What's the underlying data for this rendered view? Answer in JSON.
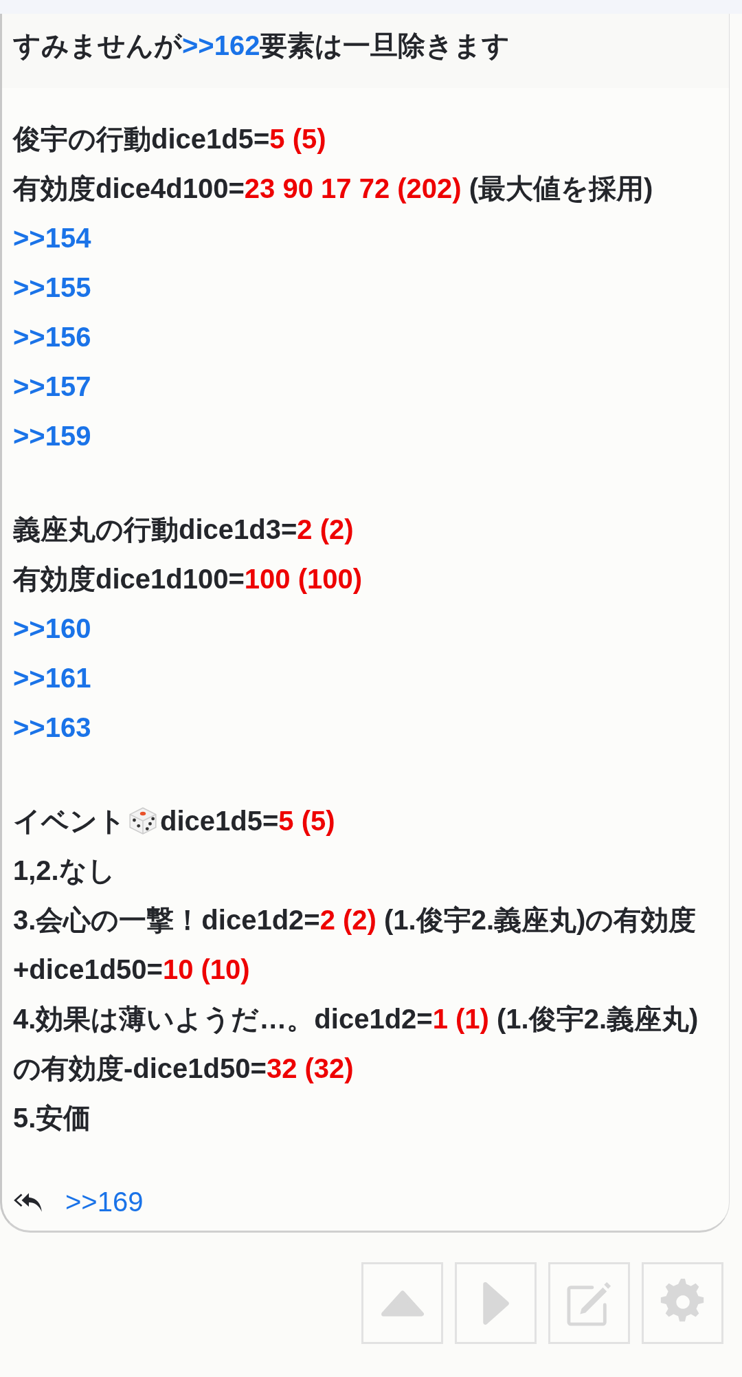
{
  "post": {
    "header": [
      {
        "kind": "text",
        "text": "すみませんが"
      },
      {
        "kind": "link",
        "text": ">>162"
      },
      {
        "kind": "text",
        "text": "要素は一旦除きます"
      }
    ],
    "blocks": [
      [
        [
          {
            "kind": "text",
            "text": "俊宇の行動dice1d5="
          },
          {
            "kind": "roll",
            "text": "5 (5)"
          }
        ],
        [
          {
            "kind": "text",
            "text": "有効度dice4d100="
          },
          {
            "kind": "roll",
            "text": "23 90 17 72 (202)"
          },
          {
            "kind": "text",
            "text": " (最大値を採用)"
          }
        ],
        [
          {
            "kind": "link",
            "text": ">>154"
          }
        ],
        [
          {
            "kind": "link",
            "text": ">>155"
          }
        ],
        [
          {
            "kind": "link",
            "text": ">>156"
          }
        ],
        [
          {
            "kind": "link",
            "text": ">>157"
          }
        ],
        [
          {
            "kind": "link",
            "text": ">>159"
          }
        ]
      ],
      [
        [
          {
            "kind": "text",
            "text": "義座丸の行動dice1d3="
          },
          {
            "kind": "roll",
            "text": "2 (2)"
          }
        ],
        [
          {
            "kind": "text",
            "text": "有効度dice1d100="
          },
          {
            "kind": "roll",
            "text": "100 (100)"
          }
        ],
        [
          {
            "kind": "link",
            "text": ">>160"
          }
        ],
        [
          {
            "kind": "link",
            "text": ">>161"
          }
        ],
        [
          {
            "kind": "link",
            "text": ">>163"
          }
        ]
      ],
      [
        [
          {
            "kind": "text",
            "text": "イベント"
          },
          {
            "kind": "dice"
          },
          {
            "kind": "text",
            "text": "dice1d5="
          },
          {
            "kind": "roll",
            "text": "5 (5)"
          }
        ],
        [
          {
            "kind": "text",
            "text": "1,2.なし"
          }
        ],
        [
          {
            "kind": "text",
            "text": "3.会心の一撃！dice1d2="
          },
          {
            "kind": "roll",
            "text": "2 (2)"
          },
          {
            "kind": "text",
            "text": " (1.俊宇2.義座丸)の有効度+dice1d50="
          },
          {
            "kind": "roll",
            "text": "10 (10)"
          }
        ],
        [
          {
            "kind": "text",
            "text": "4.効果は薄いようだ…。dice1d2="
          },
          {
            "kind": "roll",
            "text": "1 (1)"
          },
          {
            "kind": "text",
            "text": " (1.俊宇2.義座丸)の有効度-dice1d50="
          },
          {
            "kind": "roll",
            "text": "32 (32)"
          }
        ],
        [
          {
            "kind": "text",
            "text": "5.安価"
          }
        ]
      ]
    ],
    "reply_link": ">>169"
  },
  "float_buttons": [
    {
      "kind": "up"
    },
    {
      "kind": "next"
    },
    {
      "kind": "edit"
    },
    {
      "kind": "settings"
    }
  ]
}
